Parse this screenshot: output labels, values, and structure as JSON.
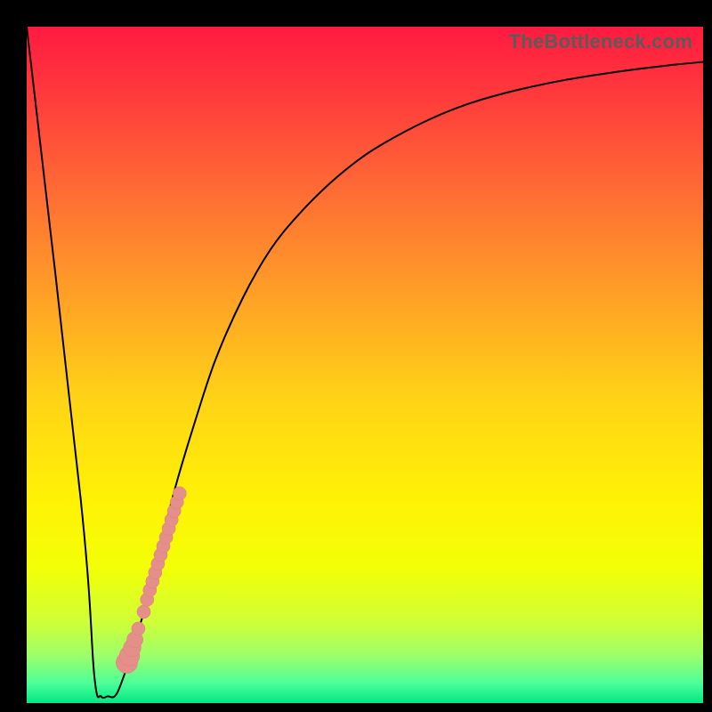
{
  "watermark": "TheBottleneck.com",
  "colors": {
    "frame": "#000000",
    "curve": "#000000",
    "dot_fill": "#e58f8b",
    "dot_stroke": "#de7e7a"
  },
  "gradient_stops": [
    {
      "offset": 0.0,
      "color": "#ff1a40"
    },
    {
      "offset": 0.1,
      "color": "#ff3a3c"
    },
    {
      "offset": 0.25,
      "color": "#ff6e34"
    },
    {
      "offset": 0.4,
      "color": "#ffa126"
    },
    {
      "offset": 0.55,
      "color": "#ffd316"
    },
    {
      "offset": 0.7,
      "color": "#fff205"
    },
    {
      "offset": 0.8,
      "color": "#f3ff06"
    },
    {
      "offset": 0.88,
      "color": "#cfff37"
    },
    {
      "offset": 0.93,
      "color": "#9cff6a"
    },
    {
      "offset": 0.97,
      "color": "#4dff99"
    },
    {
      "offset": 1.0,
      "color": "#00e884"
    }
  ],
  "chart_data": {
    "type": "line",
    "title": "",
    "xlabel": "",
    "ylabel": "",
    "xlim": [
      0,
      100
    ],
    "ylim": [
      0,
      100
    ],
    "series": [
      {
        "name": "bottleneck-curve",
        "x": [
          0,
          8,
          10,
          11,
          12,
          13,
          14,
          16,
          18,
          20,
          22,
          25,
          28,
          32,
          36,
          40,
          45,
          50,
          55,
          60,
          65,
          70,
          75,
          80,
          85,
          90,
          95,
          100
        ],
        "values": [
          100,
          30,
          4,
          1,
          1,
          1,
          3,
          9,
          16,
          24,
          32,
          42,
          51,
          60,
          67,
          72,
          77,
          81,
          84,
          86.5,
          88.5,
          90,
          91.2,
          92.2,
          93,
          93.7,
          94.3,
          94.8
        ]
      }
    ],
    "dots": {
      "name": "highlight-points",
      "points": [
        {
          "x": 14.8,
          "y": 6.0,
          "r": 1.6
        },
        {
          "x": 15.2,
          "y": 7.0,
          "r": 1.5
        },
        {
          "x": 15.6,
          "y": 8.2,
          "r": 1.3
        },
        {
          "x": 16.0,
          "y": 9.4,
          "r": 1.2
        },
        {
          "x": 16.5,
          "y": 11.0,
          "r": 1.0
        },
        {
          "x": 17.3,
          "y": 13.5,
          "r": 1.0
        },
        {
          "x": 17.8,
          "y": 15.3,
          "r": 1.0
        },
        {
          "x": 18.2,
          "y": 16.7,
          "r": 1.0
        },
        {
          "x": 18.6,
          "y": 18.0,
          "r": 1.0
        },
        {
          "x": 19.0,
          "y": 19.3,
          "r": 1.0
        },
        {
          "x": 19.4,
          "y": 20.6,
          "r": 1.0
        },
        {
          "x": 19.8,
          "y": 21.9,
          "r": 1.0
        },
        {
          "x": 20.2,
          "y": 23.2,
          "r": 1.0
        },
        {
          "x": 20.6,
          "y": 24.5,
          "r": 1.0
        },
        {
          "x": 21.0,
          "y": 25.8,
          "r": 1.0
        },
        {
          "x": 21.4,
          "y": 27.1,
          "r": 1.0
        },
        {
          "x": 21.8,
          "y": 28.4,
          "r": 1.0
        },
        {
          "x": 22.2,
          "y": 29.7,
          "r": 1.0
        },
        {
          "x": 22.6,
          "y": 31.0,
          "r": 1.0
        }
      ]
    }
  }
}
